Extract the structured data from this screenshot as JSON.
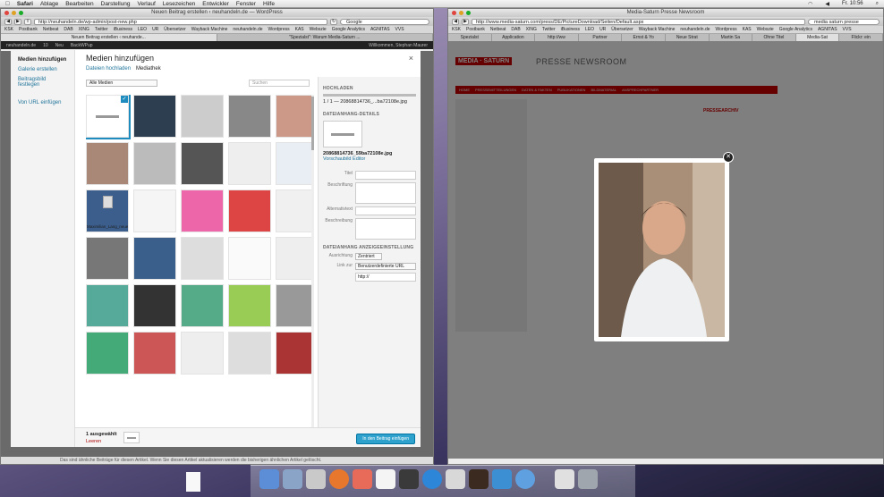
{
  "menubar": {
    "items": [
      "Safari",
      "Ablage",
      "Bearbeiten",
      "Darstellung",
      "Verlauf",
      "Lesezeichen",
      "Entwickler",
      "Fenster",
      "Hilfe"
    ],
    "clock": "Fr. 10:56"
  },
  "left": {
    "title": "Neuen Beitrag erstellen ‹ neuhandeln.de — WordPress",
    "url": "http://neuhandeln.de/wp-admin/post-new.php",
    "search_placeholder": "Google",
    "bookmarks": [
      "KSK",
      "Postbank",
      "Netbeat",
      "DAB",
      "XING",
      "Twitter",
      "iBusiness",
      "LEO",
      "UR",
      "Übersetzer",
      "Wayback Machine",
      "neuhandeln.de",
      "Wordpress",
      "KAS",
      "Webszie",
      "Google Analytics",
      "AGNITAS",
      "VVS"
    ],
    "tabs": [
      "Neuen Beitrag erstellen ‹ neuhande...",
      "\"Spezialst\": Warum Media-Saturn ..."
    ],
    "wpbar": [
      "neuhandeln.de",
      "10",
      "Neu",
      "BackWPup"
    ],
    "wp_greeting": "Willkommen, Stephan Maurer",
    "status": "Das sind ähnliche Beiträge für diesen Artikel. Wenn Sie diesen Artikel aktualisieren werden die bisherigen ähnlichen Artikel gelöscht."
  },
  "modal": {
    "side": [
      "Medien hinzufügen",
      "Galerie erstellen",
      "Beitragsbild festlegen",
      "Von URL einfügen"
    ],
    "title": "Medien hinzufügen",
    "close": "×",
    "tabs": [
      "Dateien hochladen",
      "Mediathek"
    ],
    "filter": "Alle Medien",
    "search": "Suchen",
    "pdf_name": "Maximilian_Lang_neuer_GF_StreetOne.pdf",
    "details": {
      "upload_h": "HOCHLADEN",
      "upload_file": "1 / 1 — 20868814736_...ba72108e.jpg",
      "att_h": "DATEIANHANG-DETAILS",
      "file": "20868814736_59ba72108e.jpg",
      "edit_link": "Vorschaubild Editor",
      "labels": [
        "Titel",
        "Beschriftung",
        "Alternativtext",
        "Beschreibung"
      ],
      "display_h": "DATEIANHANG ANZEIGEEINSTELLUNG",
      "align_label": "Ausrichtung",
      "align_val": "Zentriert",
      "link_label": "Link zur",
      "link_val": "Benutzerdefinierte URL",
      "link_url": "http://"
    },
    "foot": {
      "count": "1 ausgewählt",
      "clear": "Leeren",
      "insert": "In den Beitrag einfügen"
    }
  },
  "right": {
    "title": "Media-Saturn Presse Newsroom",
    "url": "http://www.media-saturn.com/press/DE/PictureDownload/Seiten/Default.aspx",
    "search": "media saturn presse",
    "bookmarks": [
      "KSK",
      "Postbank",
      "Netbeat",
      "DAB",
      "XING",
      "Twitter",
      "iBusiness",
      "LEO",
      "UR",
      "Übersetzer",
      "Wayback Machine",
      "neuhandeln.de",
      "Wordpress",
      "KAS",
      "Webszie",
      "Google Analytics",
      "AGNITAS",
      "VVS"
    ],
    "tabs": [
      "Spezialst",
      "Application",
      "http://ww",
      "Partner",
      "Ernst & Yo",
      "Neue Strat",
      "Martin Sa",
      "Ohne Titel",
      "Media-Sat",
      "Flickr: ein"
    ],
    "logo": "MEDIA · SATURN",
    "newsroom": "PRESSE NEWSROOM",
    "nav": [
      "HOME",
      "PRESSEMITTEILUNGEN",
      "DATEN & FAKTEN",
      "PUBLIKATIONEN",
      "BILDMATERIAL",
      "ANSPRECHPARTNER"
    ],
    "presse_archiv": "PRESSEARCHIV"
  }
}
